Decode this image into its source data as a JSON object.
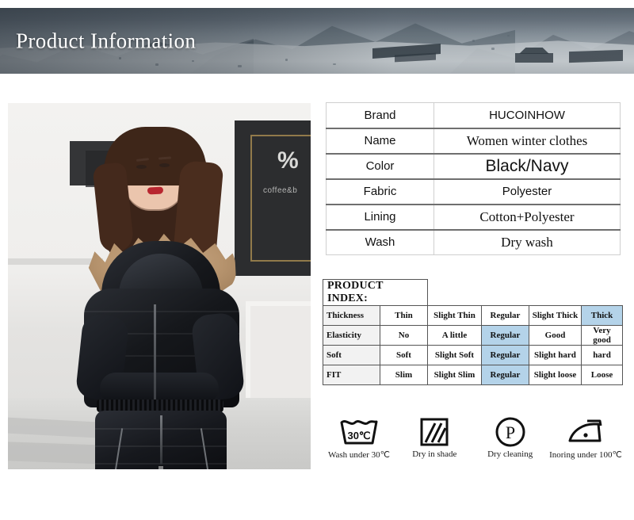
{
  "banner": {
    "title": "Product Information",
    "image_alt": "snowy-mountain-lodge-photo"
  },
  "product_photo": {
    "alt": "woman-wearing-black-hooded-down-jacket-and-snow-pants",
    "storefront_percent_sign": "%",
    "storefront_text": "coffee&b"
  },
  "spec_table": {
    "rows": [
      {
        "key": "Brand",
        "value": "HUCOINHOW"
      },
      {
        "key": "Name",
        "value": "Women winter clothes"
      },
      {
        "key": "Color",
        "value": "Black/Navy"
      },
      {
        "key": "Fabric",
        "value": "Polyester"
      },
      {
        "key": "Lining",
        "value": "Cotton+Polyester"
      },
      {
        "key": "Wash",
        "value": "Dry wash"
      }
    ]
  },
  "product_index": {
    "title": "PRODUCT INDEX:",
    "highlight_color": "#b4d3e9",
    "rows": [
      {
        "label": "Thickness",
        "cells": [
          "Thin",
          "Slight Thin",
          "Regular",
          "Slight Thick",
          "Thick"
        ],
        "selected_index": 4
      },
      {
        "label": "Elasticity",
        "cells": [
          "No",
          "A little",
          "Regular",
          "Good",
          "Very good"
        ],
        "selected_index": 2
      },
      {
        "label": "Soft",
        "cells": [
          "Soft",
          "Slight Soft",
          "Regular",
          "Slight hard",
          "hard"
        ],
        "selected_index": 2
      },
      {
        "label": "FIT",
        "cells": [
          "Slim",
          "Slight Slim",
          "Regular",
          "Slight loose",
          "Loose"
        ],
        "selected_index": 2
      }
    ]
  },
  "care_instructions": [
    {
      "icon": "wash-basin-icon",
      "icon_text": "30℃",
      "label": "Wash under 30℃"
    },
    {
      "icon": "dry-in-shade-icon",
      "icon_text": "",
      "label": "Dry in shade"
    },
    {
      "icon": "dry-cleaning-icon",
      "icon_text": "P",
      "label": "Dry cleaning"
    },
    {
      "icon": "iron-icon",
      "icon_text": "",
      "label": "Inoring under 100℃"
    }
  ]
}
